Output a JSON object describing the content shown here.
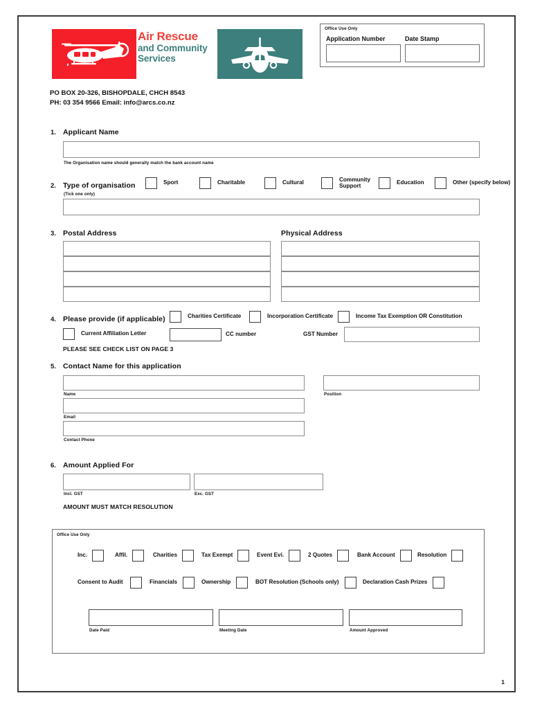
{
  "brand": {
    "line1": "Air Rescue",
    "line2a": "and Community",
    "line2b": "Services",
    "red": "#f41f28",
    "teal": "#3c7f7c",
    "heli_icon": "helicopter-icon",
    "plane_icon": "airplane-icon"
  },
  "contact": {
    "address_line1": "PO BOX 20-326, BISHOPDALE, CHCH 8543",
    "address_line2": "PH: 03 354 9566      Email: info@arcs.co.nz"
  },
  "office_top": {
    "caption": "Office Use Only",
    "application_number_label": "Application Number",
    "date_stamp_label": "Date Stamp",
    "application_number_value": "",
    "date_stamp_value": ""
  },
  "sections": {
    "s1": {
      "num": "1.",
      "title": "Applicant Name",
      "value": "",
      "hint": "The Organisation name should generally match the bank account name"
    },
    "s2": {
      "num": "2.",
      "title": "Type of organisation",
      "subtitle": "(Tick one only)",
      "options": [
        {
          "label": "Sport",
          "checked": false
        },
        {
          "label": "Charitable",
          "checked": false
        },
        {
          "label": "Cultural",
          "checked": false
        },
        {
          "label": "Community Support",
          "checked": false
        },
        {
          "label": "Education",
          "checked": false
        },
        {
          "label": "Other (specify below)",
          "checked": false
        }
      ],
      "other_value": ""
    },
    "s3": {
      "num": "3.",
      "postal_title": "Postal Address",
      "physical_title": "Physical Address",
      "postal_lines": [
        "",
        "",
        "",
        ""
      ],
      "physical_lines": [
        "",
        "",
        "",
        ""
      ]
    },
    "s4": {
      "num": "4.",
      "title": "Please provide (if applicable)",
      "checks_row1": [
        {
          "label": "Charities Certificate",
          "checked": false
        },
        {
          "label": "Incorporation Certificate",
          "checked": false
        },
        {
          "label": "Income Tax Exemption OR Constitution",
          "checked": false
        }
      ],
      "affiliation_label": "Current Affiliation Letter",
      "affiliation_checked": false,
      "cc_number_label": "CC number",
      "cc_number_value": "",
      "gst_number_label": "GST Number",
      "gst_number_value": "",
      "note": "PLEASE SEE CHECK LIST ON PAGE 3"
    },
    "s5": {
      "num": "5.",
      "title": "Contact Name for this application",
      "name_label": "Name",
      "name_value": "",
      "position_label": "Position",
      "position_value": "",
      "email_label": "Email",
      "email_value": "",
      "phone_label": "Contact Phone",
      "phone_value": ""
    },
    "s6": {
      "num": "6.",
      "title": "Amount Applied For",
      "incl_label": "Incl. GST",
      "incl_value": "",
      "exc_label": "Exc. GST",
      "exc_value": "",
      "note": "AMOUNT MUST MATCH RESOLUTION"
    }
  },
  "office_bottom": {
    "caption": "Office Use Only",
    "row1": [
      {
        "label": "Inc.",
        "checked": false
      },
      {
        "label": "Affil.",
        "checked": false
      },
      {
        "label": "Charities",
        "checked": false
      },
      {
        "label": "Tax Exempt",
        "checked": false
      },
      {
        "label": "Event Evi.",
        "checked": false
      },
      {
        "label": "2 Quotes",
        "checked": false
      },
      {
        "label": "Bank Account",
        "checked": false
      },
      {
        "label": "Resolution",
        "checked": false
      }
    ],
    "row2": [
      {
        "label": "Consent to Audit",
        "checked": false
      },
      {
        "label": "Financials",
        "checked": false
      },
      {
        "label": "Ownership",
        "checked": false
      },
      {
        "label": "BOT Resolution (Schools only)",
        "checked": false
      },
      {
        "label": "Declaration Cash Prizes",
        "checked": false
      }
    ],
    "date_paid_label": "Date Paid",
    "date_paid_value": "",
    "meeting_date_label": "Meeting Date",
    "meeting_date_value": "",
    "amount_approved_label": "Amount Approved",
    "amount_approved_value": ""
  },
  "footer": {
    "page_number": "1"
  }
}
